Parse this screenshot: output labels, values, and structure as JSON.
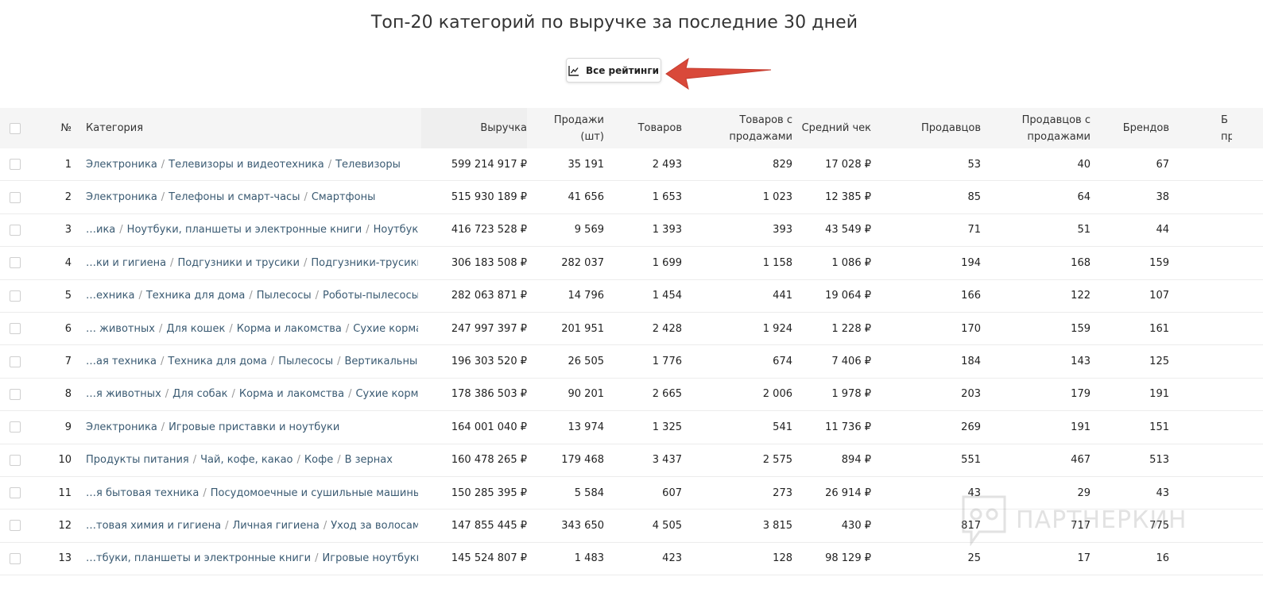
{
  "page": {
    "title": "Топ-20 категорий по выручке за последние 30 дней",
    "all_ratings_button": "Все рейтинги",
    "watermark": "ПАРТНЕРКИН"
  },
  "colors": {
    "link": "#3a5a72",
    "arrow": "#d9493a",
    "header_bg": "#f5f5f5"
  },
  "table": {
    "columns": {
      "num": "№",
      "category": "Категория",
      "revenue": "Выручка",
      "sales": "Продажи (шт)",
      "products": "Товаров",
      "products_with_sales": "Товаров с продажами",
      "avg_check": "Средний чек",
      "sellers": "Продавцов",
      "sellers_with_sales": "Продавцов с продажами",
      "brands": "Брендов",
      "brands_with_sales_partial": "Б пр"
    },
    "rows": [
      {
        "num": "1",
        "path": [
          "Электроника",
          "Телевизоры и видеотехника",
          "Телевизоры"
        ],
        "revenue": "599 214 917 ₽",
        "sales": "35 191",
        "products": "2 493",
        "pws": "829",
        "avg": "17 028 ₽",
        "sellers": "53",
        "sws": "40",
        "brands": "67"
      },
      {
        "num": "2",
        "path": [
          "Электроника",
          "Телефоны и смарт-часы",
          "Смартфоны"
        ],
        "revenue": "515 930 189 ₽",
        "sales": "41 656",
        "products": "1 653",
        "pws": "1 023",
        "avg": "12 385 ₽",
        "sellers": "85",
        "sws": "64",
        "brands": "38"
      },
      {
        "num": "3",
        "path": [
          "…ика",
          "Ноутбуки, планшеты и электронные книги",
          "Ноутбуки"
        ],
        "revenue": "416 723 528 ₽",
        "sales": "9 569",
        "products": "1 393",
        "pws": "393",
        "avg": "43 549 ₽",
        "sellers": "71",
        "sws": "51",
        "brands": "44"
      },
      {
        "num": "4",
        "path": [
          "…ки и гигиена",
          "Подгузники и трусики",
          "Подгузники-трусики"
        ],
        "revenue": "306 183 508 ₽",
        "sales": "282 037",
        "products": "1 699",
        "pws": "1 158",
        "avg": "1 086 ₽",
        "sellers": "194",
        "sws": "168",
        "brands": "159"
      },
      {
        "num": "5",
        "path": [
          "…ехника",
          "Техника для дома",
          "Пылесосы",
          "Роботы-пылесосы"
        ],
        "revenue": "282 063 871 ₽",
        "sales": "14 796",
        "products": "1 454",
        "pws": "441",
        "avg": "19 064 ₽",
        "sellers": "166",
        "sws": "122",
        "brands": "107"
      },
      {
        "num": "6",
        "path": [
          "… животных",
          "Для кошек",
          "Корма и лакомства",
          "Сухие корма"
        ],
        "revenue": "247 997 397 ₽",
        "sales": "201 951",
        "products": "2 428",
        "pws": "1 924",
        "avg": "1 228 ₽",
        "sellers": "170",
        "sws": "159",
        "brands": "161"
      },
      {
        "num": "7",
        "path": [
          "…ая техника",
          "Техника для дома",
          "Пылесосы",
          "Вертикальные"
        ],
        "revenue": "196 303 520 ₽",
        "sales": "26 505",
        "products": "1 776",
        "pws": "674",
        "avg": "7 406 ₽",
        "sellers": "184",
        "sws": "143",
        "brands": "125"
      },
      {
        "num": "8",
        "path": [
          "…я животных",
          "Для собак",
          "Корма и лакомства",
          "Сухие корма"
        ],
        "revenue": "178 386 503 ₽",
        "sales": "90 201",
        "products": "2 665",
        "pws": "2 006",
        "avg": "1 978 ₽",
        "sellers": "203",
        "sws": "179",
        "brands": "191"
      },
      {
        "num": "9",
        "path": [
          "Электроника",
          "Игровые приставки и ноутбуки"
        ],
        "revenue": "164 001 040 ₽",
        "sales": "13 974",
        "products": "1 325",
        "pws": "541",
        "avg": "11 736 ₽",
        "sellers": "269",
        "sws": "191",
        "brands": "151"
      },
      {
        "num": "10",
        "path": [
          "Продукты питания",
          "Чай, кофе, какао",
          "Кофе",
          "В зернах"
        ],
        "revenue": "160 478 265 ₽",
        "sales": "179 468",
        "products": "3 437",
        "pws": "2 575",
        "avg": "894 ₽",
        "sellers": "551",
        "sws": "467",
        "brands": "513"
      },
      {
        "num": "11",
        "path": [
          "…я бытовая техника",
          "Посудомоечные и сушильные машины"
        ],
        "revenue": "150 285 395 ₽",
        "sales": "5 584",
        "products": "607",
        "pws": "273",
        "avg": "26 914 ₽",
        "sellers": "43",
        "sws": "29",
        "brands": "43"
      },
      {
        "num": "12",
        "path": [
          "…товая химия и гигиена",
          "Личная гигиена",
          "Уход за волосами"
        ],
        "revenue": "147 855 445 ₽",
        "sales": "343 650",
        "products": "4 505",
        "pws": "3 815",
        "avg": "430 ₽",
        "sellers": "817",
        "sws": "717",
        "brands": "775"
      },
      {
        "num": "13",
        "path": [
          "…тбуки, планшеты и электронные книги",
          "Игровые ноутбуки"
        ],
        "revenue": "145 524 807 ₽",
        "sales": "1 483",
        "products": "423",
        "pws": "128",
        "avg": "98 129 ₽",
        "sellers": "25",
        "sws": "17",
        "brands": "16"
      }
    ]
  }
}
